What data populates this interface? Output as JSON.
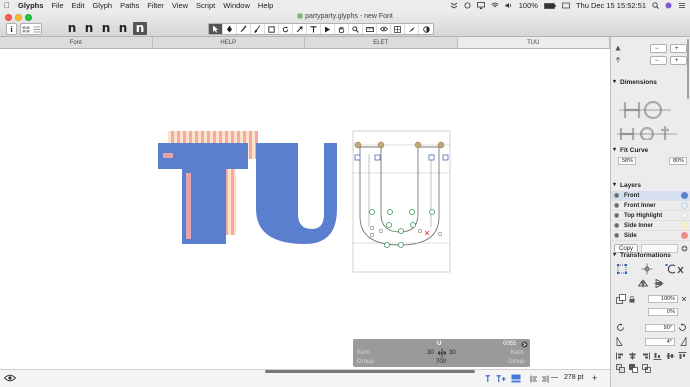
{
  "menubar": {
    "app_name": "Glyphs",
    "items": [
      "File",
      "Edit",
      "Glyph",
      "Paths",
      "Filter",
      "View",
      "Script",
      "Window",
      "Help"
    ],
    "battery": "100%",
    "clock": "Thu Dec 15  15:52:51"
  },
  "window": {
    "title": "partyparty.glyphs - new Font"
  },
  "toolbar": {
    "info_label": "i",
    "layer_buttons": [
      "n",
      "n",
      "n",
      "n",
      "n"
    ],
    "tools": [
      "select-tool",
      "pen-tool",
      "pencil-tool",
      "brush-tool",
      "rectangle-tool",
      "rotate-tool",
      "scale-tool",
      "text-tool",
      "annotation-tool",
      "hand-tool",
      "zoom-tool",
      "measure-tool",
      "preview-tool",
      "grid-tool",
      "knife-tool",
      "compare-tool"
    ]
  },
  "tabs": [
    "Font",
    "HELP",
    "ELET",
    "TUU"
  ],
  "canvas": {
    "text": "TUU",
    "colors": {
      "front": "#5b7fcf",
      "front_inner": "#e7eefb",
      "top_highlight": "#fde3c8",
      "side_inner": "#f3d9b4",
      "side": "#ef8c8c"
    }
  },
  "info_panel": {
    "glyph_name": "U",
    "unicode": "0055",
    "left_kern_label": "Kern",
    "right_kern_label": "Kern",
    "left_sb": "30",
    "right_sb": "30",
    "width": "700",
    "left_group_label": "Group",
    "right_group_label": "Group"
  },
  "bottombar": {
    "zoom": "278 pt"
  },
  "sidebar": {
    "dimensions_title": "Dimensions",
    "fit_curve_title": "Fit Curve",
    "fit_min": "58%",
    "fit_max": "80%",
    "layers_title": "Layers",
    "layers": [
      {
        "name": "Front",
        "color": "#5b7fcf",
        "selected": true
      },
      {
        "name": "Front Inner",
        "color": "#e7eefb",
        "selected": false
      },
      {
        "name": "Top Highlight",
        "color": "#f3f3f3",
        "selected": false
      },
      {
        "name": "Side Inner",
        "color": "#f7efc4",
        "selected": false
      },
      {
        "name": "Side",
        "color": "#ef8c8c",
        "selected": false
      }
    ],
    "copy_label": "Copy",
    "transformations_title": "Transformations",
    "scale_value": "100%",
    "scale_value2": "0%",
    "rotate_value": "90°",
    "slant_value": "4°"
  }
}
